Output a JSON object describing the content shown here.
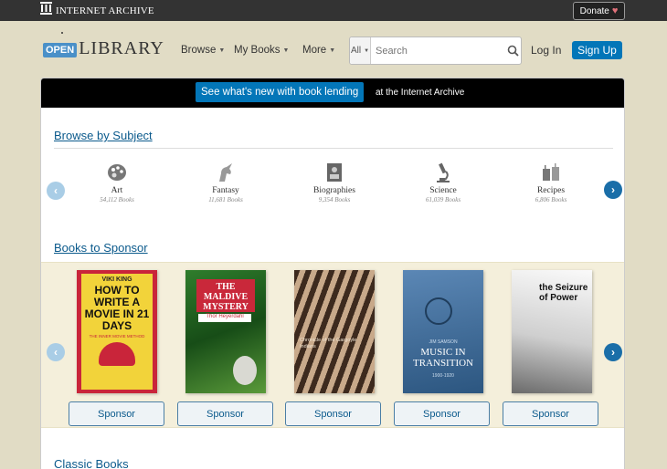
{
  "ia_bar": {
    "logo_text": "INTERNET ARCHIVE",
    "donate_label": "Donate",
    "donate_heart": "♥"
  },
  "header": {
    "logo_open": "OPEN",
    "logo_library": "LIBRARY",
    "nav": [
      {
        "label": "Browse"
      },
      {
        "label": "My Books"
      },
      {
        "label": "More"
      }
    ],
    "search": {
      "scope": "All",
      "placeholder": "Search"
    },
    "login_label": "Log In",
    "signup_label": "Sign Up"
  },
  "banner": {
    "button_label": "See what's new with book lending",
    "suffix": "at the Internet Archive"
  },
  "browse": {
    "title": "Browse by Subject",
    "subjects": [
      {
        "name": "Art",
        "count": "54,112 Books",
        "icon": "palette-icon"
      },
      {
        "name": "Fantasy",
        "count": "11,681 Books",
        "icon": "unicorn-icon"
      },
      {
        "name": "Biographies",
        "count": "9,354 Books",
        "icon": "portrait-icon"
      },
      {
        "name": "Science",
        "count": "61,039 Books",
        "icon": "microscope-icon"
      },
      {
        "name": "Recipes",
        "count": "6,806 Books",
        "icon": "kitchen-icon"
      }
    ]
  },
  "sponsor": {
    "title": "Books to Sponsor",
    "button_label": "Sponsor",
    "books": [
      {
        "author": "VIKI KING",
        "title": "HOW TO WRITE A MOVIE IN 21 DAYS",
        "subtitle": "THE INNER MOVIE METHOD"
      },
      {
        "title": "THE MALDIVE MYSTERY",
        "author": "Thor Heyerdahl"
      },
      {
        "title": "Chronicle of the Gargoyle Indians"
      },
      {
        "author": "JIM SAMSON",
        "title": "MUSIC IN TRANSITION",
        "years": "1900-1920"
      },
      {
        "title": "the Seizure of Power"
      }
    ]
  },
  "classic": {
    "title": "Classic Books"
  }
}
